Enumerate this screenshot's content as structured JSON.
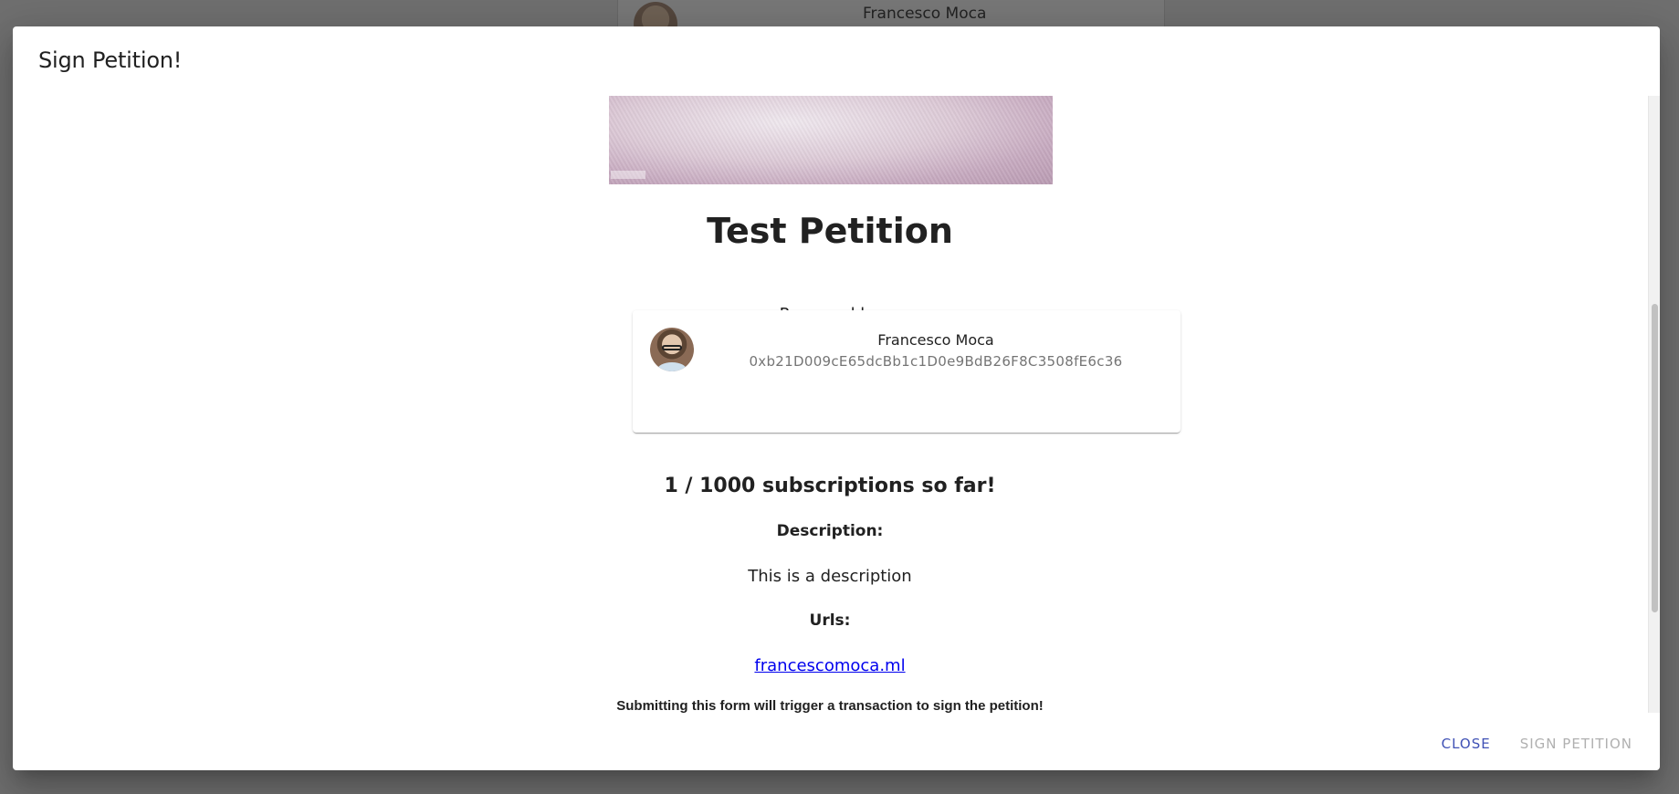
{
  "background": {
    "author_name": "Francesco Moca"
  },
  "dialog": {
    "title": "Sign Petition!",
    "petition_title": "Test Petition",
    "proposed_by_label": "Proposed by",
    "author": {
      "name": "Francesco Moca",
      "address": "0xb21D009cE65dcBb1c1D0e9BdB26F8C3508fE6c36"
    },
    "subscriptions_text": "1 / 1000 subscriptions so far!",
    "description_label": "Description:",
    "description": "This is a description",
    "urls_label": "Urls:",
    "url": "francescomoca.ml",
    "notice": "Submitting this form will trigger a transaction to sign the petition!",
    "actions": {
      "close_label": "CLOSE",
      "sign_label": "SIGN PETITION"
    }
  },
  "colors": {
    "primary": "#3f51b5",
    "disabled": "#b0b0b0",
    "link": "#0000ee",
    "overlay": "#6f6f6f"
  }
}
